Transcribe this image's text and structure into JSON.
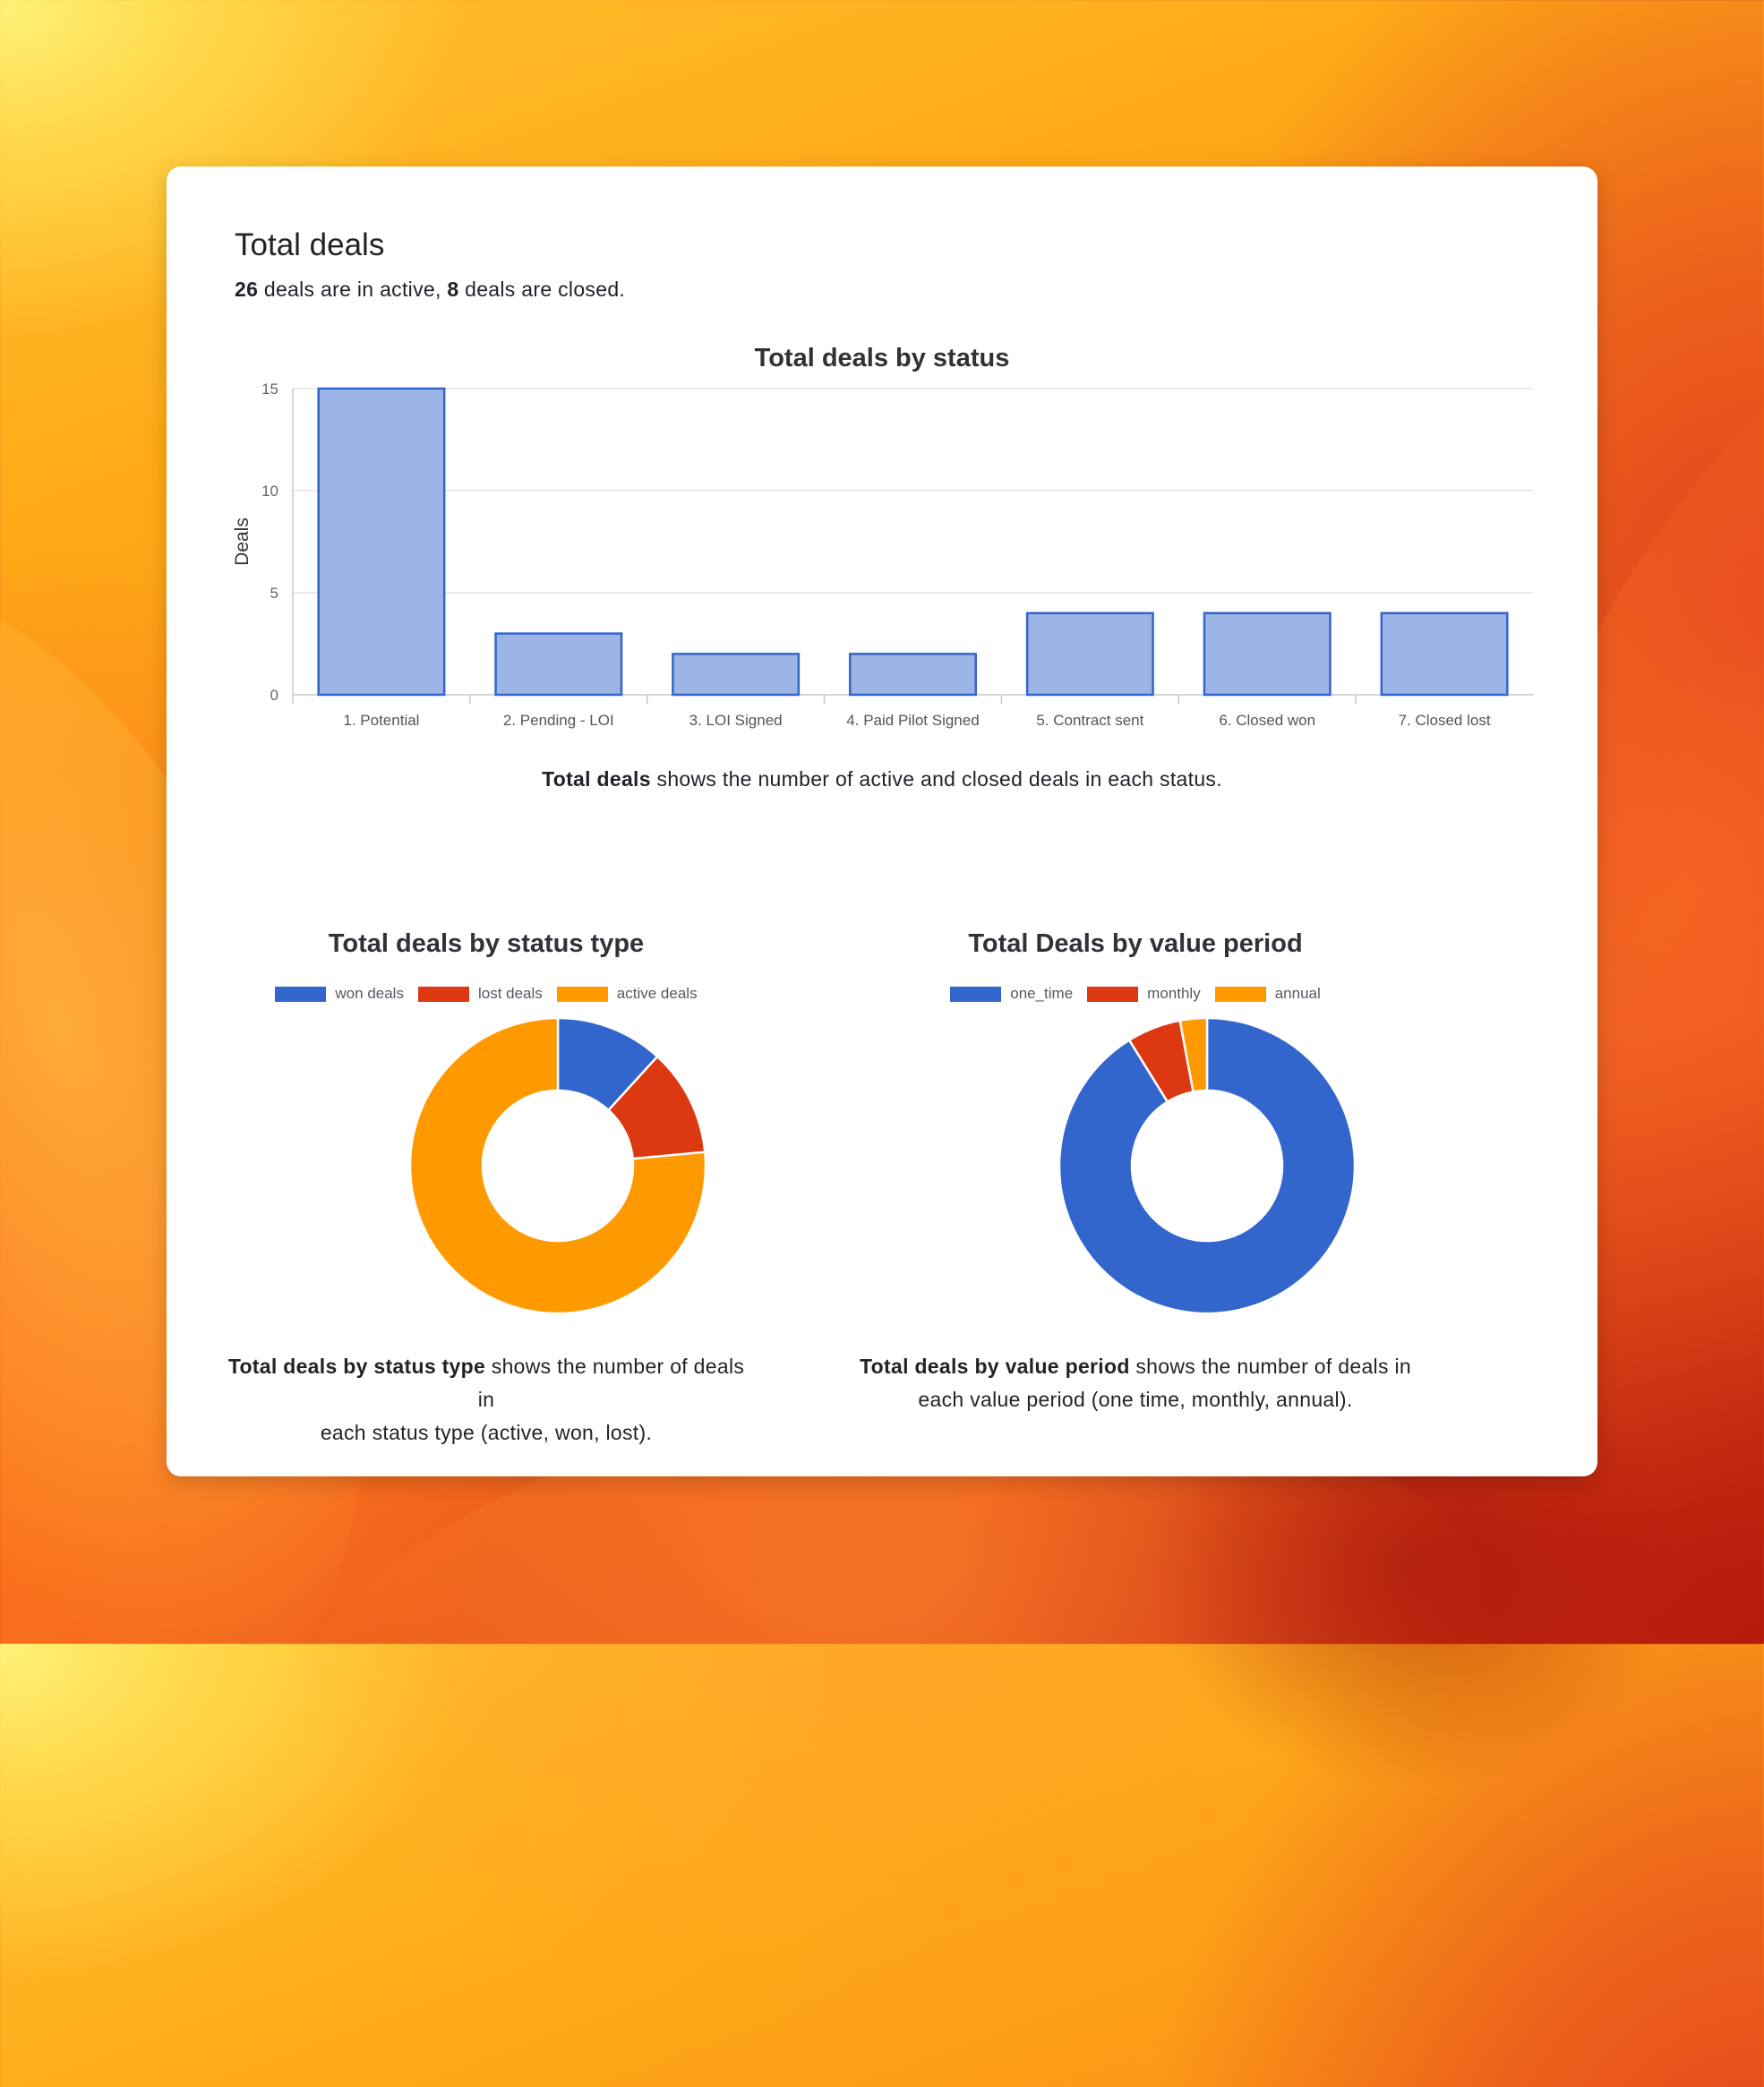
{
  "header": {
    "title": "Total deals",
    "active_count": "26",
    "active_text": " deals are in active, ",
    "closed_count": "8",
    "closed_text": " deals are closed."
  },
  "colors": {
    "bar_fill": "#9db4e6",
    "bar_stroke": "#3366cc",
    "blue": "#3366cc",
    "red": "#dc3912",
    "orange": "#ff9900"
  },
  "chart_data": [
    {
      "type": "bar",
      "title": "Total deals by status",
      "xlabel": "",
      "ylabel": "Deals",
      "categories": [
        "1. Potential",
        "2. Pending - LOI",
        "3. LOI Signed",
        "4. Paid Pilot Signed",
        "5. Contract sent",
        "6. Closed won",
        "7. Closed lost"
      ],
      "values": [
        15,
        3,
        2,
        2,
        4,
        4,
        4
      ],
      "ylim": [
        0,
        15
      ],
      "yticks": [
        0,
        5,
        10,
        15
      ],
      "grid": true,
      "caption_bold": "Total deals",
      "caption_rest": " shows the number of active and closed deals in each status."
    },
    {
      "type": "pie",
      "donut": true,
      "title": "Total deals by status type",
      "legend_position": "top",
      "labels": [
        "won deals",
        "lost deals",
        "active deals"
      ],
      "values": [
        4,
        4,
        26
      ],
      "colors": [
        "#3366cc",
        "#dc3912",
        "#ff9900"
      ],
      "caption_bold": "Total deals by status type",
      "caption_line1": " shows the number of deals in",
      "caption_line2": "each status type (active, won, lost)."
    },
    {
      "type": "pie",
      "donut": true,
      "title": "Total Deals by value period",
      "legend_position": "top",
      "labels": [
        "one_time",
        "monthly",
        "annual"
      ],
      "values": [
        31,
        2,
        1
      ],
      "colors": [
        "#3366cc",
        "#dc3912",
        "#ff9900"
      ],
      "caption_bold": "Total deals by value period",
      "caption_line1": " shows the number of deals in",
      "caption_line2": "each value period (one time, monthly, annual)."
    }
  ]
}
